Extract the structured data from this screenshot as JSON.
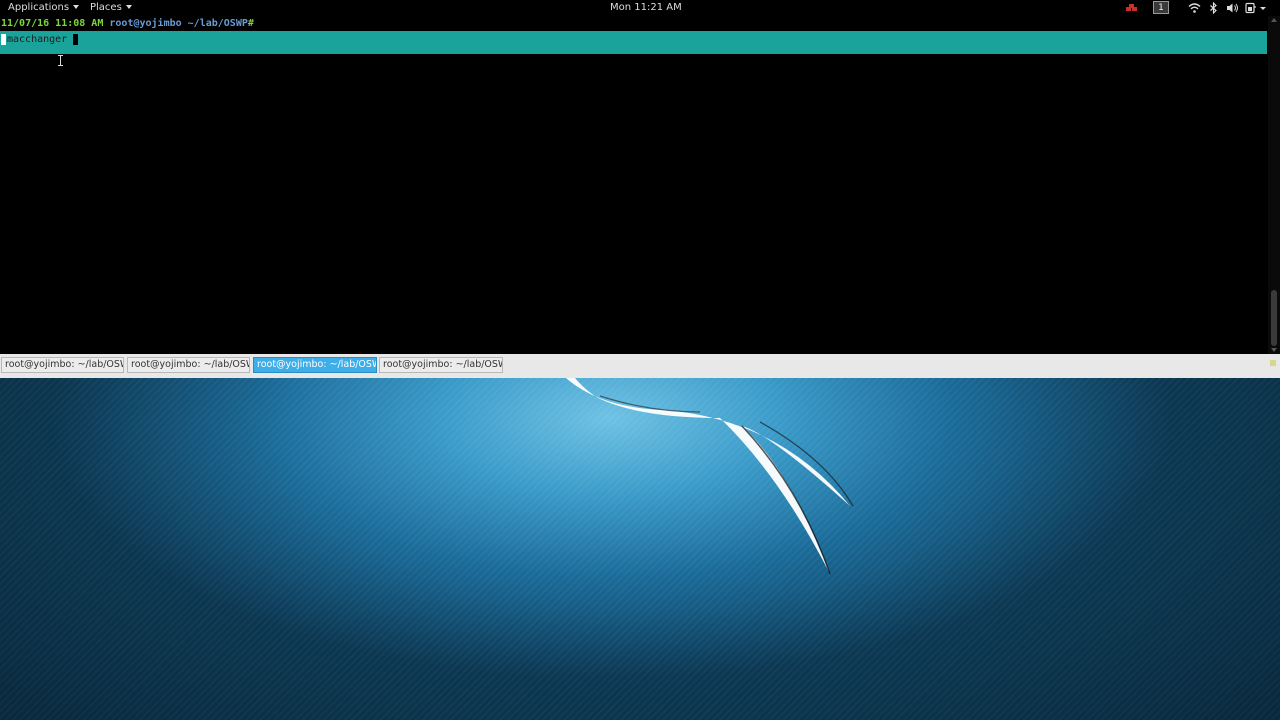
{
  "top_panel": {
    "applications_label": "Applications",
    "places_label": "Places",
    "clock": "Mon 11:21 AM",
    "workspace_number": "1",
    "tray_icons": [
      "wifi-icon",
      "bluetooth-icon",
      "volume-icon",
      "power-icon"
    ]
  },
  "terminal": {
    "prompt": {
      "timestamp": "11/07/16 11:08 AM",
      "user_path": "root@yojimbo ~/lab/OSWP",
      "symbol": "#"
    },
    "command_text": "macchanger"
  },
  "tabs": [
    {
      "label": "root@yojimbo: ~/lab/OSWP",
      "active": false
    },
    {
      "label": "root@yojimbo: ~/lab/OSWP",
      "active": false
    },
    {
      "label": "root@yojimbo: ~/lab/OSWP",
      "active": true
    },
    {
      "label": "root@yojimbo: ~/lab/OSWP",
      "active": false
    }
  ],
  "colors": {
    "terminal_background": "#000000",
    "command_highlight": "#1aa39b",
    "prompt_timestamp": "#7cd73b",
    "prompt_user": "#6a9bd4",
    "active_tab": "#3daee9",
    "tray_alert": "#c9302c"
  }
}
